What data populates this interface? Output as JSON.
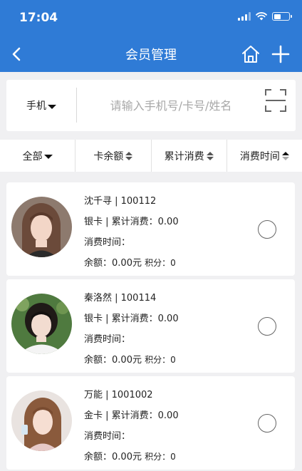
{
  "status_bar": {
    "time": "17:04"
  },
  "nav": {
    "title": "会员管理"
  },
  "search": {
    "type_label": "手机",
    "placeholder": "请输入手机号/卡号/姓名"
  },
  "filters": [
    {
      "label": "全部"
    },
    {
      "label": "卡余额"
    },
    {
      "label": "累计消费"
    },
    {
      "label": "消费时间"
    }
  ],
  "members": [
    {
      "name_line": "沈千寻 | 100112",
      "card_line": "银卡 | 累计消费：0.00",
      "time_label": "消费时间：",
      "balance_label": "余额：",
      "balance": "0.00元",
      "points_label": "积分：",
      "points": "0"
    },
    {
      "name_line": "秦洛然 | 100114",
      "card_line": "银卡 | 累计消费：0.00",
      "time_label": "消费时间：",
      "balance_label": "余额：",
      "balance": "0.00元",
      "points_label": "积分：",
      "points": "0"
    },
    {
      "name_line": "万能 | 1001002",
      "card_line": "金卡 | 累计消费：0.00",
      "time_label": "消费时间：",
      "balance_label": "余额：",
      "balance": "0.00元",
      "points_label": "积分：",
      "points": "0"
    }
  ],
  "colors": {
    "header": "#2f7bd6",
    "background": "#f0f0f2",
    "card": "#ffffff"
  },
  "icons": [
    "back-icon",
    "home-icon",
    "plus-icon",
    "scan-icon",
    "signal-icon",
    "wifi-icon",
    "battery-icon"
  ]
}
